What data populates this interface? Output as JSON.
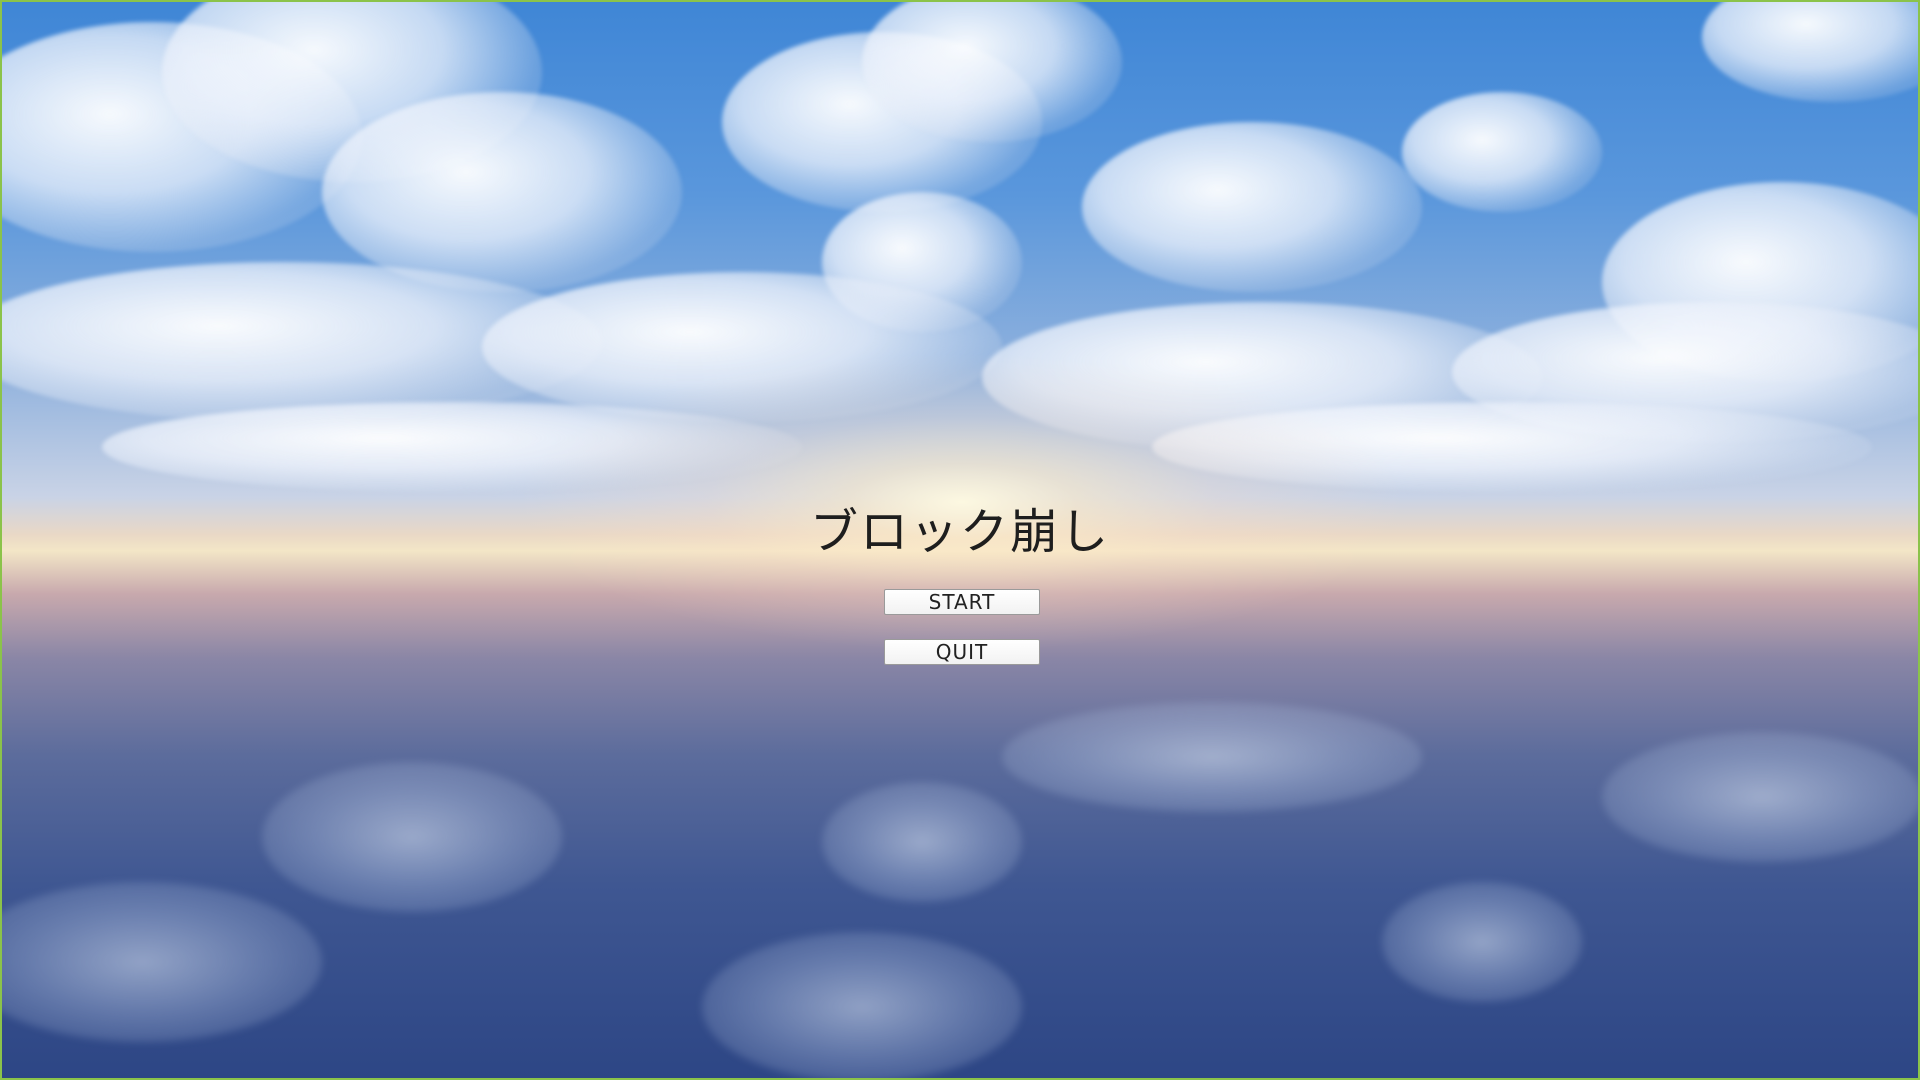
{
  "game": {
    "title": "ブロック崩し"
  },
  "menu": {
    "start_label": "START",
    "quit_label": "QUIT"
  },
  "colors": {
    "border": "#8bc34a",
    "sky_top": "#3f86d6",
    "horizon": "#f3e6c7",
    "water_bottom": "#2d4685",
    "button_bg": "#ffffff",
    "title_text": "#1e1e1e"
  }
}
